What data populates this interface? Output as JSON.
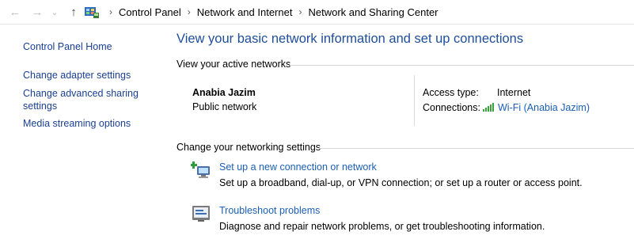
{
  "breadcrumb": {
    "items": [
      "Control Panel",
      "Network and Internet",
      "Network and Sharing Center"
    ],
    "separator": "›"
  },
  "nav": {
    "back": "←",
    "forward": "→",
    "recent": "⌄",
    "up": "↑"
  },
  "sidebar": {
    "items": [
      {
        "label": "Control Panel Home"
      },
      {
        "label": "Change adapter settings"
      },
      {
        "label": "Change advanced sharing\nsettings",
        "line1": "Change advanced sharing",
        "line2": "settings"
      },
      {
        "label": "Media streaming options"
      }
    ]
  },
  "main": {
    "title": "View your basic network information and set up connections",
    "active_networks_heading": "View your active networks",
    "network_name": "Anabia Jazim",
    "network_type": "Public network",
    "access_type_label": "Access type:",
    "access_type_value": "Internet",
    "connections_label": "Connections:",
    "connections_value": "Wi-Fi (Anabia Jazim)",
    "settings_heading": "Change your networking settings",
    "tasks": [
      {
        "title": "Set up a new connection or network",
        "desc": "Set up a broadband, dial-up, or VPN connection; or set up a router or access point.",
        "icon": "network-setup-icon"
      },
      {
        "title": "Troubleshoot problems",
        "desc": "Diagnose and repair network problems, or get troubleshooting information.",
        "icon": "troubleshoot-icon"
      }
    ]
  },
  "colors": {
    "link": "#1a5fb4",
    "title": "#1e4e9a",
    "wifi_signal": "#3aa23a"
  }
}
